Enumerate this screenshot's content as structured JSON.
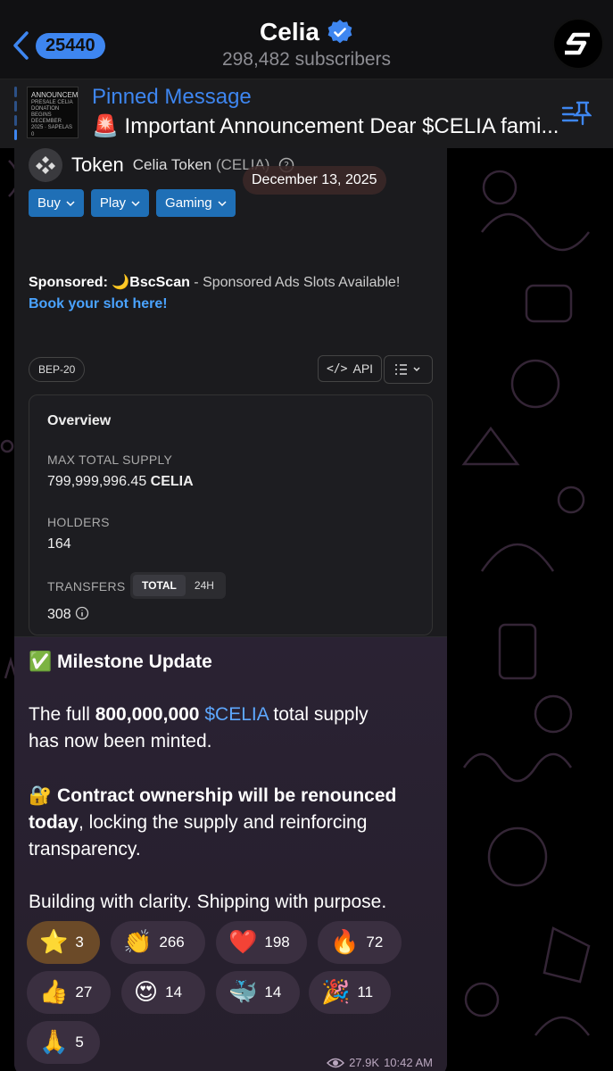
{
  "header": {
    "back_count": "25440",
    "title": "Celia",
    "subtitle": "298,482 subscribers"
  },
  "pinned": {
    "title": "Pinned Message",
    "text": "🚨 Important Announcement Dear $CELIA fami...",
    "thumb_heading": "ANNOUNCEMENT",
    "thumb_text": "PRESALE CELIA DONATION BEGINS DECEMBER 2025 · SAPELAS 0"
  },
  "date_badge": "December 13, 2025",
  "token_page": {
    "label": "Token",
    "name": "Celia Token",
    "symbol": "(CELIA)",
    "menu": [
      "Buy",
      "Play",
      "Gaming"
    ],
    "sponsored_prefix": "Sponsored:",
    "sponsor_name": "BscScan",
    "sponsored_text": " - Sponsored Ads Slots Available!",
    "book": "Book your slot here!",
    "chip": "BEP-20",
    "api": "API",
    "overview_title": "Overview",
    "max_supply_label": "MAX TOTAL SUPPLY",
    "max_supply_value": "799,999,996.45",
    "max_supply_unit": "CELIA",
    "holders_label": "HOLDERS",
    "holders_value": "164",
    "transfers_label": "TRANSFERS",
    "toggle": [
      "TOTAL",
      "24H"
    ],
    "transfers_value": "308"
  },
  "message": {
    "heading_emoji": "✅",
    "heading": "Milestone Update",
    "p1_a": "The full ",
    "p1_b": "800,000,000",
    "p1_c": " ",
    "p1_d": "$CELIA",
    "p1_e": " total supply",
    "p1_f": "has now been minted.",
    "p2_emoji": "🔐",
    "p2_a": " Contract ownership will be renounced",
    "p2_b": "today",
    "p2_c": ", locking the supply and reinforcing",
    "p2_d": "transparency.",
    "p3": "Building with clarity. Shipping with purpose."
  },
  "reactions": [
    {
      "emoji": "⭐",
      "count": "3"
    },
    {
      "emoji": "👏",
      "count": "266"
    },
    {
      "emoji": "❤️",
      "count": "198"
    },
    {
      "emoji": "🔥",
      "count": "72"
    },
    {
      "emoji": "👍",
      "count": "27"
    },
    {
      "emoji": "😍",
      "count": "14"
    },
    {
      "emoji": "🐳",
      "count": "14"
    },
    {
      "emoji": "🎉",
      "count": "11"
    },
    {
      "emoji": "🙏",
      "count": "5"
    }
  ],
  "meta": {
    "views": "27.9K",
    "time": "10:42 AM"
  },
  "colors": {
    "accent": "#3e86f0",
    "menu_button": "#1f6fb6",
    "link": "#4aa3ff",
    "bubble": "#2a2233"
  }
}
